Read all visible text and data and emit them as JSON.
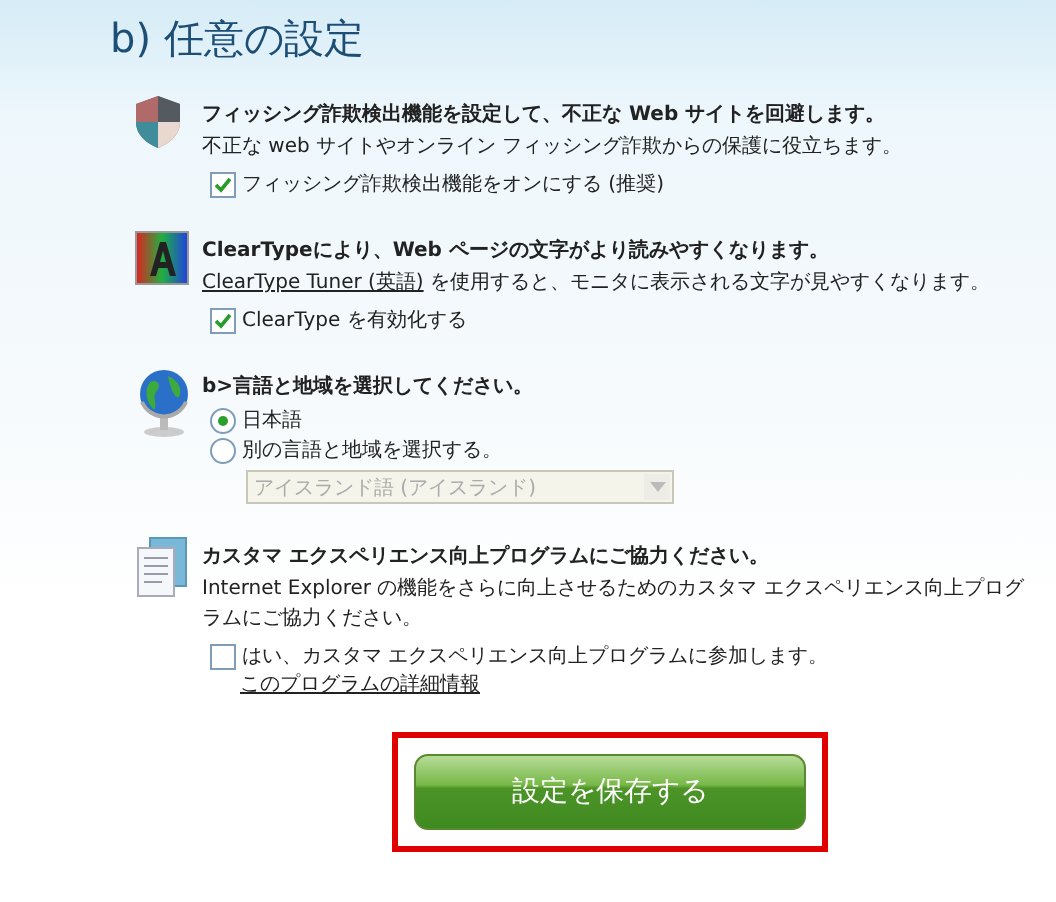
{
  "title": "b) 任意の設定",
  "sections": [
    {
      "kind": "checkbox",
      "heading": "フィッシング詐欺検出機能を設定して、不正な Web サイトを回避します。",
      "description": "不正な web サイトやオンライン フィッシング詐欺からの保護に役立ちます。",
      "option": {
        "label": "フィッシング詐欺検出機能をオンにする (推奨)",
        "checked": true
      }
    },
    {
      "kind": "checkbox",
      "heading": "ClearTypeにより、Web ページの文字がより読みやすくなります。",
      "link": "ClearType Tuner (英語)",
      "description": "を使用すると、モニタに表示される文字が見やすくなります。",
      "option": {
        "label": "ClearType を有効化する",
        "checked": true
      }
    },
    {
      "kind": "radio",
      "heading": "b>言語と地域を選択してください。",
      "choices": [
        {
          "label": "日本語",
          "selected": true
        },
        {
          "label": "別の言語と地域を選択する。",
          "selected": false
        }
      ],
      "dropdown": {
        "value": "アイスランド語 (アイスランド)",
        "disabled": true
      }
    },
    {
      "kind": "checkbox",
      "heading": "カスタマ エクスペリエンス向上プログラムにご協力ください。",
      "description": "Internet Explorer の機能をさらに向上させるためのカスタマ エクスペリエンス向上プログラムにご協力ください。",
      "option": {
        "label": "はい、カスタマ エクスペリエンス向上プログラムに参加します。",
        "checked": false
      },
      "detail_link": "このプログラムの詳細情報"
    }
  ],
  "save_button": {
    "label": "設定を保存する",
    "highlighted": true
  }
}
